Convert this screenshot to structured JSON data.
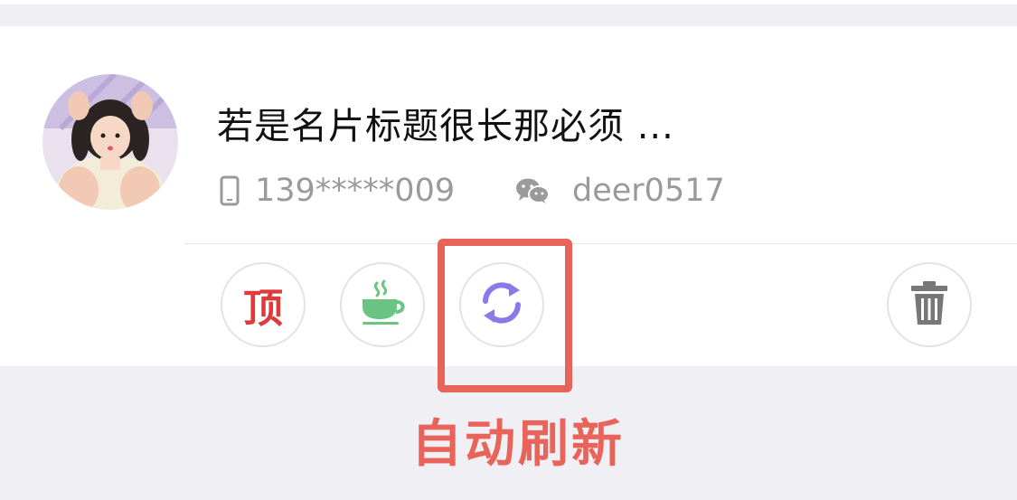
{
  "card": {
    "title": "若是名片标题很长那必须 ...",
    "phone": "139*****009",
    "wechat": "deer0517"
  },
  "actions": [
    {
      "name": "pin-top",
      "label": "顶",
      "color": "#e03a3a"
    },
    {
      "name": "tea",
      "icon": "tea-cup-icon",
      "color": "#6cc483"
    },
    {
      "name": "auto-refresh",
      "icon": "refresh-icon",
      "color": "#8c78e8"
    },
    {
      "name": "delete",
      "icon": "trash-icon",
      "color": "#777777"
    }
  ],
  "annotation": {
    "label": "自动刷新",
    "color": "#e8645a"
  }
}
